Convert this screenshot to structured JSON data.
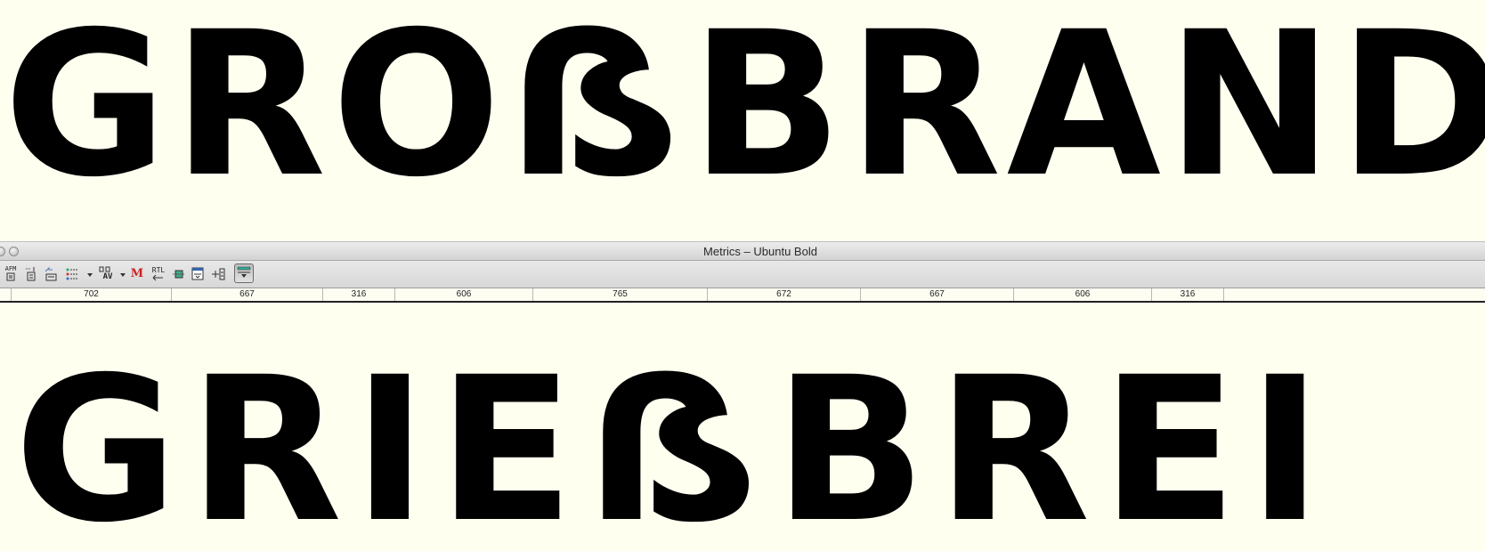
{
  "preview": {
    "top_text": "GROẞBRAND",
    "bottom_text": "GRIEẞBREI"
  },
  "window": {
    "title": "Metrics – Ubuntu Bold"
  },
  "toolbar": {
    "buttons": [
      {
        "icon": "afm-import-icon",
        "label": "AFM"
      },
      {
        "icon": "new-metrics-icon",
        "label": ""
      },
      {
        "icon": "open-font-icon",
        "label": ""
      },
      {
        "icon": "list-options-icon",
        "label": ""
      },
      {
        "icon": "kerning-av-icon",
        "label": "AV"
      },
      {
        "icon": "metrics-m-icon",
        "label": "M"
      },
      {
        "icon": "rtl-icon",
        "label": "RTL"
      },
      {
        "icon": "width-align-icon",
        "label": ""
      },
      {
        "icon": "window-panel-icon",
        "label": ""
      },
      {
        "icon": "insert-glyph-icon",
        "label": ""
      },
      {
        "icon": "toggle-preview-icon",
        "label": ""
      }
    ]
  },
  "ruler": {
    "widths": [
      "702",
      "667",
      "316",
      "606",
      "765",
      "672",
      "667",
      "606",
      "316"
    ]
  }
}
